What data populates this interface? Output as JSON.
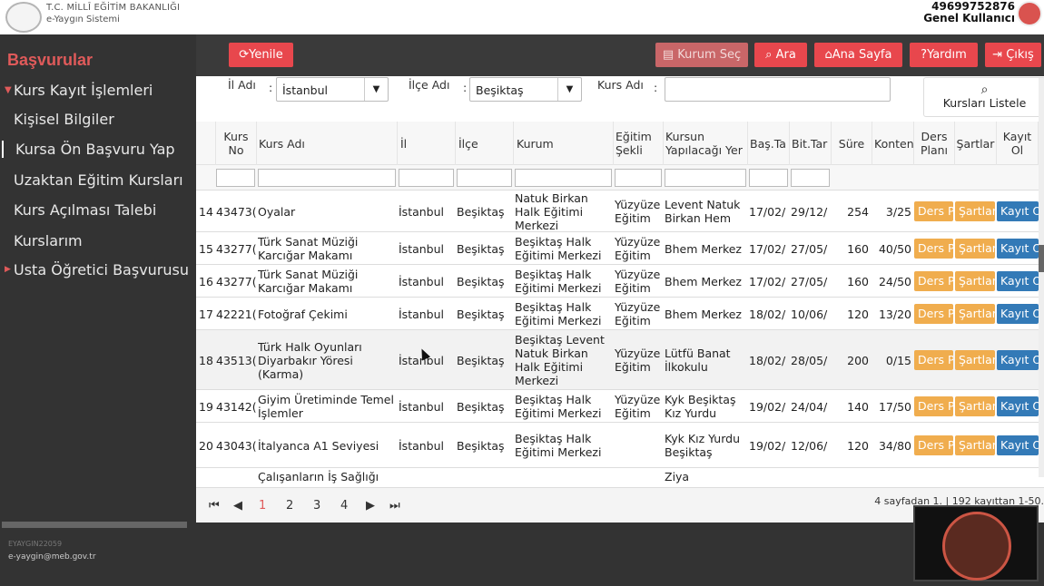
{
  "header": {
    "ministry": "T.C. MİLLÎ EĞİTİM BAKANLIĞI",
    "system": "e-Yaygın Sistemi",
    "user_id": "49699752876",
    "user_role": "Genel Kullanıcı"
  },
  "sidebar": {
    "title": "Başvurular",
    "items": [
      {
        "label": "Kurs Kayıt İşlemleri",
        "expandable": true
      },
      {
        "label": "Kişisel Bilgiler"
      },
      {
        "label": "Kursa Ön Başvuru Yap",
        "active": true
      },
      {
        "label": "Uzaktan Eğitim Kursları"
      },
      {
        "label": "Kurs Açılması Talebi"
      },
      {
        "label": "Kurslarım"
      },
      {
        "label": "Usta Öğretici Başvurusu",
        "expandable": true
      }
    ],
    "footer_code": "EYAYGIN22059",
    "footer_email": "e-yaygin@meb.gov.tr"
  },
  "toolbar": {
    "refresh": "Yenile",
    "select_course": "Kurum Seç",
    "search": "Ara",
    "home": "Ana Sayfa",
    "help": "Yardım",
    "logout": "Çıkış"
  },
  "filters": {
    "il_label": "İl Adı",
    "il_value": "İstanbul",
    "ilce_label": "İlçe Adı",
    "ilce_value": "Beşiktaş",
    "kurs_label": "Kurs Adı",
    "kurs_value": "",
    "list_button": "Kursları Listele"
  },
  "table": {
    "columns": [
      "Kurs No",
      "Kurs Adı",
      "İl",
      "İlçe",
      "Kurum",
      "Eğitim Şekli",
      "Kursun Yapılacağı Yer",
      "Baş.Ta",
      "Bit.Tar",
      "Süre",
      "Konten",
      "Ders Planı",
      "Şartlar",
      "Kayıt Ol"
    ],
    "row_buttons": {
      "plan": "Ders P",
      "terms": "Şartlar",
      "register": "Kayıt O"
    },
    "rows": [
      {
        "idx": "14",
        "no": "43473(",
        "name": "Oyalar",
        "il": "İstanbul",
        "ilce": "Beşiktaş",
        "kurum": "Natuk Birkan Halk Eğitimi Merkezi",
        "sekil": "Yüzyüze Eğitim",
        "yer": "Levent Natuk Birkan Hem",
        "bas": "17/02/",
        "bit": "29/12/",
        "sure": "254",
        "kontenjan": "3/25"
      },
      {
        "idx": "15",
        "no": "43277(",
        "name": "Türk Sanat Müziği Karcığar Makamı",
        "il": "İstanbul",
        "ilce": "Beşiktaş",
        "kurum": "Beşiktaş Halk Eğitimi Merkezi",
        "sekil": "Yüzyüze Eğitim",
        "yer": "Bhem Merkez",
        "bas": "17/02/",
        "bit": "27/05/",
        "sure": "160",
        "kontenjan": "40/50"
      },
      {
        "idx": "16",
        "no": "43277(",
        "name": "Türk Sanat Müziği Karcığar Makamı",
        "il": "İstanbul",
        "ilce": "Beşiktaş",
        "kurum": "Beşiktaş Halk Eğitimi Merkezi",
        "sekil": "Yüzyüze Eğitim",
        "yer": "Bhem Merkez",
        "bas": "17/02/",
        "bit": "27/05/",
        "sure": "160",
        "kontenjan": "24/50"
      },
      {
        "idx": "17",
        "no": "42221(",
        "name": "Fotoğraf Çekimi",
        "il": "İstanbul",
        "ilce": "Beşiktaş",
        "kurum": "Beşiktaş Halk Eğitimi Merkezi",
        "sekil": "Yüzyüze Eğitim",
        "yer": "Bhem Merkez",
        "bas": "18/02/",
        "bit": "10/06/",
        "sure": "120",
        "kontenjan": "13/20"
      },
      {
        "idx": "18",
        "no": "43513(",
        "name": "Türk Halk Oyunları Diyarbakır Yöresi (Karma)",
        "il": "İstanbul",
        "ilce": "Beşiktaş",
        "kurum": "Beşiktaş Levent Natuk Birkan Halk Eğitimi Merkezi",
        "sekil": "Yüzyüze Eğitim",
        "yer": "Lütfü Banat İlkokulu",
        "bas": "18/02/",
        "bit": "28/05/",
        "sure": "200",
        "kontenjan": "0/15"
      },
      {
        "idx": "19",
        "no": "43142(",
        "name": "Giyim Üretiminde Temel İşlemler",
        "il": "İstanbul",
        "ilce": "Beşiktaş",
        "kurum": "Beşiktaş Halk Eğitimi Merkezi",
        "sekil": "Yüzyüze Eğitim",
        "yer": "Kyk Beşiktaş Kız Yurdu",
        "bas": "19/02/",
        "bit": "24/04/",
        "sure": "140",
        "kontenjan": "17/50"
      },
      {
        "idx": "20",
        "no": "43043(",
        "name": "İtalyanca A1 Seviyesi",
        "il": "İstanbul",
        "ilce": "Beşiktaş",
        "kurum": "Beşiktaş Halk Eğitimi Merkezi",
        "sekil": "",
        "yer": "Kyk Kız Yurdu Beşiktaş",
        "bas": "19/02/",
        "bit": "12/06/",
        "sure": "120",
        "kontenjan": "34/80"
      },
      {
        "idx": "",
        "no": "",
        "name": "Çalışanların İş Sağlığı",
        "il": "",
        "ilce": "",
        "kurum": "",
        "sekil": "",
        "yer": "Ziya",
        "bas": "",
        "bit": "",
        "sure": "",
        "kontenjan": ""
      }
    ]
  },
  "pager": {
    "first": "⏮",
    "prev": "◀",
    "pages": [
      "1",
      "2",
      "3",
      "4"
    ],
    "current": "1",
    "next": "▶",
    "last": "⏭",
    "info": "4 sayfadan 1. | 192 kayıttan 1-50."
  }
}
